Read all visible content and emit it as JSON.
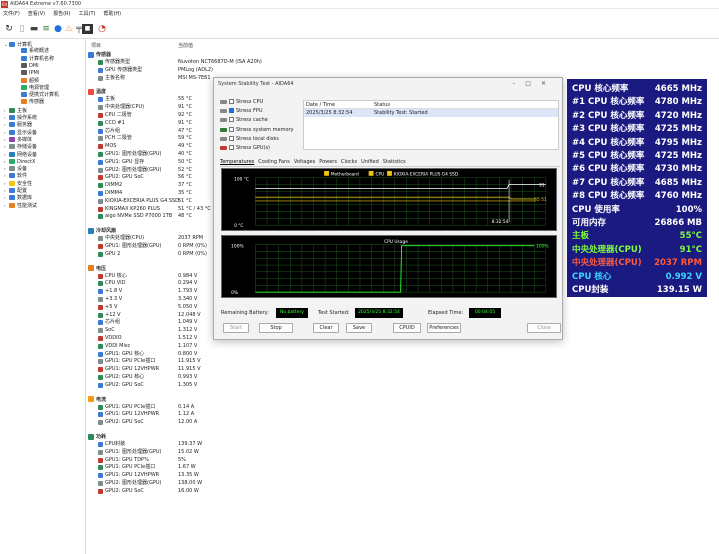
{
  "window": {
    "title": "AIDA64 Extreme v7.60.7300"
  },
  "menu": [
    "文件(F)",
    "查看(V)",
    "报告(R)",
    "工具(T)",
    "帮助(H)"
  ],
  "list_headers": {
    "item": "项目",
    "value": "当前值"
  },
  "tree": [
    {
      "label": "计算机",
      "level": 0,
      "color": "#3a7bd5"
    },
    {
      "label": "系统概述",
      "level": 1,
      "color": "#3a7bd5"
    },
    {
      "label": "计算机名称",
      "level": 1,
      "color": "#3a7bd5"
    },
    {
      "label": "DMI",
      "level": 1,
      "color": "#5a5a5a"
    },
    {
      "label": "IPMI",
      "level": 1,
      "color": "#5a5a5a"
    },
    {
      "label": "超频",
      "level": 1,
      "color": "#e67e22"
    },
    {
      "label": "电源管理",
      "level": 1,
      "color": "#27ae60"
    },
    {
      "label": "便携式计算机",
      "level": 1,
      "color": "#3a7bd5"
    },
    {
      "label": "传感器",
      "level": 1,
      "color": "#e67e22"
    },
    {
      "label": "主板",
      "level": 0,
      "color": "#2e8b57"
    },
    {
      "label": "操作系统",
      "level": 0,
      "color": "#3a7bd5"
    },
    {
      "label": "服务器",
      "level": 0,
      "color": "#3a7bd5"
    },
    {
      "label": "显示设备",
      "level": 0,
      "color": "#3a7bd5"
    },
    {
      "label": "多媒体",
      "level": 0,
      "color": "#8e44ad"
    },
    {
      "label": "存储设备",
      "level": 0,
      "color": "#7f8c8d"
    },
    {
      "label": "网络设备",
      "level": 0,
      "color": "#2980b9"
    },
    {
      "label": "DirectX",
      "level": 0,
      "color": "#27ae60"
    },
    {
      "label": "设备",
      "level": 0,
      "color": "#7f8c8d"
    },
    {
      "label": "软件",
      "level": 0,
      "color": "#3a7bd5"
    },
    {
      "label": "安全性",
      "level": 0,
      "color": "#f1c40f"
    },
    {
      "label": "配置",
      "level": 0,
      "color": "#3a7bd5"
    },
    {
      "label": "数据库",
      "level": 0,
      "color": "#3a7bd5"
    },
    {
      "label": "性能测试",
      "level": 0,
      "color": "#e67e22"
    }
  ],
  "sections": [
    {
      "title": "传感器",
      "rows": [
        {
          "name": "传感器类型",
          "value": "Nuvoton NCT6687D-M (ISA A20h)"
        },
        {
          "name": "GPU 传感器类型",
          "value": "PMLog (ADL2)"
        },
        {
          "name": "主板名称",
          "value": "MSI MS-7E61"
        }
      ]
    },
    {
      "title": "温度",
      "rows": [
        {
          "name": "主板",
          "value": "55 °C"
        },
        {
          "name": "中央处理器(CPU)",
          "value": "91 °C"
        },
        {
          "name": "CPU 二极管",
          "value": "92 °C"
        },
        {
          "name": "CCD #1",
          "value": "91 °C"
        },
        {
          "name": "芯片组",
          "value": "47 °C"
        },
        {
          "name": "PCH 二极管",
          "value": "59 °C"
        },
        {
          "name": "MOS",
          "value": "49 °C"
        },
        {
          "name": "GPU1: 图形处理器(GPU)",
          "value": "40 °C"
        },
        {
          "name": "GPU1: GPU 显存",
          "value": "50 °C"
        },
        {
          "name": "GPU2: 图形处理器(GPU)",
          "value": "52 °C"
        },
        {
          "name": "GPU2: GPU SoC",
          "value": "56 °C"
        },
        {
          "name": "DIMM2",
          "value": "37 °C"
        },
        {
          "name": "DIMM4",
          "value": "35 °C"
        },
        {
          "name": "KIOXIA-EXCERIA PLUS G4 SSD",
          "value": "51 °C"
        },
        {
          "name": "KINGMAX KP260 PLUS",
          "value": "51 °C / 43 °C"
        },
        {
          "name": "aigo NVMe SSD P7000 1TB",
          "value": "48 °C"
        }
      ]
    },
    {
      "title": "冷却风扇",
      "rows": [
        {
          "name": "中央处理器(CPU)",
          "value": "2037 RPM"
        },
        {
          "name": "GPU1: 图形处理器(GPU)",
          "value": "0 RPM  (0%)"
        },
        {
          "name": "GPU 2",
          "value": "0 RPM  (0%)"
        }
      ]
    },
    {
      "title": "电压",
      "rows": [
        {
          "name": "CPU 核心",
          "value": "0.984 V"
        },
        {
          "name": "CPU VID",
          "value": "0.294 V"
        },
        {
          "name": "+1.8 V",
          "value": "1.793 V"
        },
        {
          "name": "+3.3 V",
          "value": "3.340 V"
        },
        {
          "name": "+5 V",
          "value": "5.050 V"
        },
        {
          "name": "+12 V",
          "value": "12.048 V"
        },
        {
          "name": "芯片组",
          "value": "1.049 V"
        },
        {
          "name": "SoC",
          "value": "1.312 V"
        },
        {
          "name": "VDDIO",
          "value": "1.512 V"
        },
        {
          "name": "VDDI Misc",
          "value": "1.107 V"
        },
        {
          "name": "GPU1: GPU 核心",
          "value": "0.800 V"
        },
        {
          "name": "GPU1: GPU PCIe插口",
          "value": "11.915 V"
        },
        {
          "name": "GPU1: GPU 12VHPWR",
          "value": "11.915 V"
        },
        {
          "name": "GPU2: GPU 核心",
          "value": "0.993 V"
        },
        {
          "name": "GPU2: GPU SoC",
          "value": "1.305 V"
        }
      ]
    },
    {
      "title": "电流",
      "rows": [
        {
          "name": "GPU1: GPU PCIe插口",
          "value": "0.14 A"
        },
        {
          "name": "GPU1: GPU 12VHPWR",
          "value": "1.12 A"
        },
        {
          "name": "GPU2: GPU SoC",
          "value": "12.00 A"
        }
      ]
    },
    {
      "title": "功耗",
      "rows": [
        {
          "name": "CPU封装",
          "value": "139.37 W"
        },
        {
          "name": "GPU1: 图形处理器(GPU)",
          "value": "15.02 W"
        },
        {
          "name": "GPU1: GPU TDP%",
          "value": "5%"
        },
        {
          "name": "GPU1: GPU PCIe插口",
          "value": "1.67 W"
        },
        {
          "name": "GPU1: GPU 12VHPWR",
          "value": "13.35 W"
        },
        {
          "name": "GPU2: 图形处理器(GPU)",
          "value": "138.00 W"
        },
        {
          "name": "GPU2: GPU SoC",
          "value": "16.00 W"
        }
      ]
    }
  ],
  "dialog": {
    "title": "System Stability Test - AIDA64",
    "stress": [
      {
        "label": "Stress CPU",
        "checked": false,
        "color": "#888"
      },
      {
        "label": "Stress FPU",
        "checked": true,
        "color": "#888"
      },
      {
        "label": "Stress cache",
        "checked": false,
        "color": "#888"
      },
      {
        "label": "Stress system memory",
        "checked": false,
        "color": "#2e7d32"
      },
      {
        "label": "Stress local disks",
        "checked": false,
        "color": "#888"
      },
      {
        "label": "Stress GPU(s)",
        "checked": false,
        "color": "#c0392b"
      }
    ],
    "log_headers": {
      "datetime": "Date / Time",
      "status": "Status"
    },
    "log_row": {
      "datetime": "2025/3/25 8:32:54",
      "status": "Stability Test: Started"
    },
    "tabs": [
      "Temperatures",
      "Cooling Fans",
      "Voltages",
      "Powers",
      "Clocks",
      "Unified",
      "Statistics"
    ],
    "graph1": {
      "legend": [
        "Motherboard",
        "CPU",
        "KIOXIA-EXCERIA PLUS G4 SSD"
      ],
      "y_top": "100 °C",
      "y_bottom": "0 °C",
      "time_label": "8:32:54",
      "right_labels": [
        "91",
        "55 51"
      ]
    },
    "graph2": {
      "title": "CPU Usage",
      "y_top": "100%",
      "y_bottom": "0%",
      "right_label": "100%"
    },
    "status": {
      "battery_label": "Remaining Battery:",
      "battery_value": "No battery",
      "started_label": "Test Started:",
      "started_value": "2025/3/25 8:32:54",
      "elapsed_label": "Elapsed Time:",
      "elapsed_value": "00:04:05"
    },
    "buttons": [
      "Start",
      "Stop",
      "Clear",
      "Save",
      "CPUID",
      "Preferences",
      "Close"
    ]
  },
  "osd": [
    {
      "label": "CPU 核心频率",
      "value": "4665 MHz",
      "color": "#ffffff"
    },
    {
      "label": "#1 CPU 核心频率",
      "value": "4780 MHz",
      "color": "#ffffff"
    },
    {
      "label": "#2 CPU 核心频率",
      "value": "4720 MHz",
      "color": "#ffffff"
    },
    {
      "label": "#3 CPU 核心频率",
      "value": "4725 MHz",
      "color": "#ffffff"
    },
    {
      "label": "#4 CPU 核心频率",
      "value": "4795 MHz",
      "color": "#ffffff"
    },
    {
      "label": "#5 CPU 核心频率",
      "value": "4725 MHz",
      "color": "#ffffff"
    },
    {
      "label": "#6 CPU 核心频率",
      "value": "4730 MHz",
      "color": "#ffffff"
    },
    {
      "label": "#7 CPU 核心频率",
      "value": "4685 MHz",
      "color": "#ffffff"
    },
    {
      "label": "#8 CPU 核心频率",
      "value": "4760 MHz",
      "color": "#ffffff"
    },
    {
      "label": "CPU 使用率",
      "value": "100%",
      "color": "#ffffff"
    },
    {
      "label": "可用内存",
      "value": "26866 MB",
      "color": "#ffffff"
    },
    {
      "label": "主板",
      "value": "55°C",
      "color": "#7fff3a"
    },
    {
      "label": "中央处理器(CPU)",
      "value": "91°C",
      "color": "#7fff3a"
    },
    {
      "label": "中央处理器(CPU)",
      "value": "2037 RPM",
      "color": "#ff5a3a"
    },
    {
      "label": "CPU 核心",
      "value": "0.992 V",
      "color": "#3ad7ff"
    },
    {
      "label": "CPU封装",
      "value": "139.15 W",
      "color": "#ffffff"
    }
  ]
}
